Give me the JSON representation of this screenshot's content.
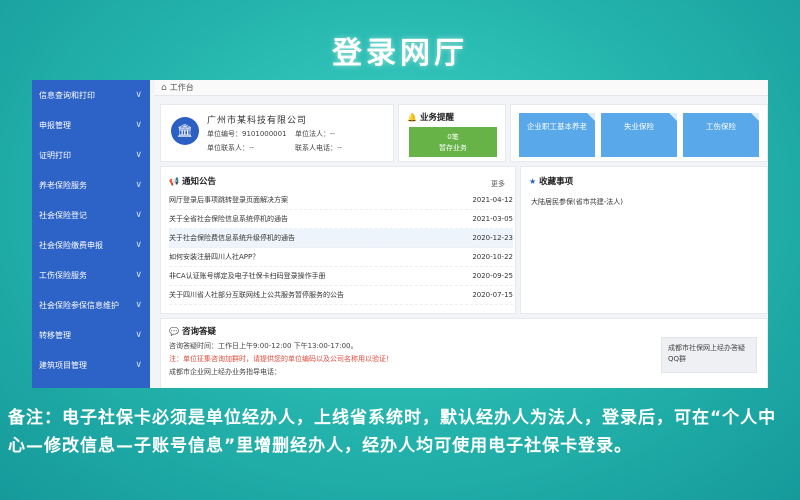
{
  "slide_title": "登录网厅",
  "sidebar": {
    "items": [
      {
        "label": "信息查询和打印"
      },
      {
        "label": "申报管理"
      },
      {
        "label": "证明打印"
      },
      {
        "label": "养老保险服务"
      },
      {
        "label": "社会保险登记"
      },
      {
        "label": "社会保险缴费申报"
      },
      {
        "label": "工伤保险服务"
      },
      {
        "label": "社会保险参保信息维护"
      },
      {
        "label": "转移管理"
      },
      {
        "label": "建筑项目管理"
      }
    ]
  },
  "topbar": {
    "home_label": "工作台"
  },
  "org": {
    "name": "广州市某科技有限公司",
    "unit_code_label": "单位编号：",
    "unit_code_value": "9101000001",
    "legal_person_label": "单位法人：",
    "legal_person_value": "--",
    "contact_label": "单位联系人：",
    "contact_value": "--",
    "contact_phone_label": "联系人电话：",
    "contact_phone_value": "--"
  },
  "reminders": {
    "title": "业务提醒",
    "count": "0笔",
    "subtitle": "暂存业务"
  },
  "tiles": [
    {
      "label": "企业职工基本养老"
    },
    {
      "label": "失业保险"
    },
    {
      "label": "工伤保险"
    }
  ],
  "notices": {
    "title": "通知公告",
    "more": "更多",
    "items": [
      {
        "title": "网厅登录后事项跳转登录页面解决方案",
        "date": "2021-04-12"
      },
      {
        "title": "关于全省社会保险信息系统停机的通告",
        "date": "2021-03-05"
      },
      {
        "title": "关于社会保险费信息系统升级停机的通告",
        "date": "2020-12-23"
      },
      {
        "title": "如何安装注册四川人社APP？",
        "date": "2020-10-22"
      },
      {
        "title": "非CA认证账号绑定及电子社保卡扫码登录操作手册",
        "date": "2020-09-25"
      },
      {
        "title": "关于四川省人社部分互联网线上公共服务暂停服务的公告",
        "date": "2020-07-15"
      }
    ]
  },
  "favorites": {
    "title": "收藏事项",
    "items": [
      {
        "label": "大陆居民参保(省市共建-法人)"
      }
    ]
  },
  "consult": {
    "title": "咨询答疑",
    "hours": "咨询答疑时间：工作日上午9:00-12:00 下午13:00-17:00。",
    "note": "注：单位征集咨询加群时，请提供您的单位编码以及公司名称用以验证！",
    "group_line": "成都市企业网上经办业务指导电话：",
    "qq_box": "成都市社保网上经办答疑QQ群"
  },
  "footnote": "备注：电子社保卡必须是单位经办人，上线省系统时，默认经办人为法人，登录后，可在“个人中心—修改信息—子账号信息”里增删经办人，经办人均可使用电子社保卡登录。",
  "colors": {
    "sidebar": "#2d63c6",
    "accent_green": "#67b347",
    "tile_blue": "#58a8ea",
    "background_teal": "#27b8b0"
  }
}
